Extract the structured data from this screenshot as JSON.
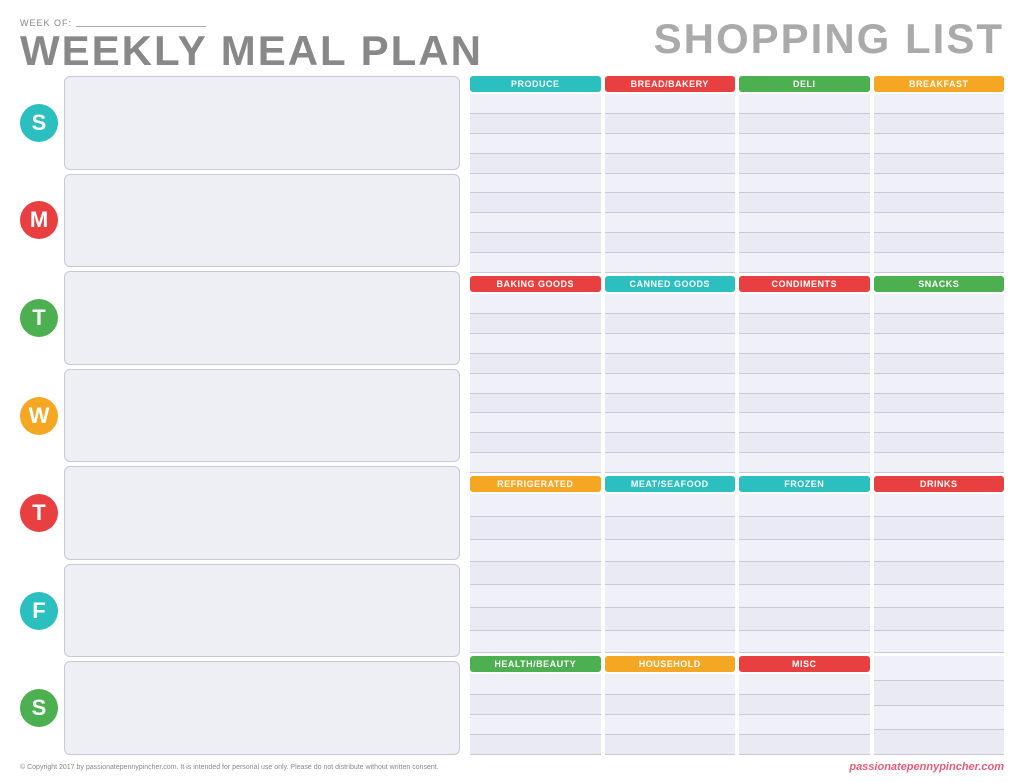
{
  "header": {
    "week_of_label": "WEEK OF:",
    "title": "WEEKLY MEAL PLAN",
    "shopping_title": "SHOPPING LIST"
  },
  "days": [
    {
      "letter": "S",
      "color_class": "day-sun"
    },
    {
      "letter": "M",
      "color_class": "day-mon"
    },
    {
      "letter": "T",
      "color_class": "day-tue"
    },
    {
      "letter": "W",
      "color_class": "day-wed"
    },
    {
      "letter": "T",
      "color_class": "day-thu"
    },
    {
      "letter": "F",
      "color_class": "day-fri"
    },
    {
      "letter": "S",
      "color_class": "day-sat"
    }
  ],
  "shopping": {
    "top": [
      {
        "label": "PRODUCE",
        "color": "#2bbfbf",
        "lines": 9
      },
      {
        "label": "BREAD/BAKERY",
        "color": "#e84040",
        "lines": 9
      },
      {
        "label": "DELI",
        "color": "#4caf50",
        "lines": 9
      },
      {
        "label": "BREAKFAST",
        "color": "#f5a623",
        "lines": 9
      }
    ],
    "mid": [
      {
        "label": "BAKING GOODS",
        "color": "#e84040",
        "lines": 9
      },
      {
        "label": "CANNED GOODS",
        "color": "#2bbfbf",
        "lines": 9
      },
      {
        "label": "CONDIMENTS",
        "color": "#e84040",
        "lines": 9
      },
      {
        "label": "SNACKS",
        "color": "#4caf50",
        "lines": 9
      }
    ],
    "bot3": [
      {
        "label": "REFRIGERATED",
        "color": "#f5a623",
        "lines": 7
      },
      {
        "label": "MEAT/SEAFOOD",
        "color": "#2bbfbf",
        "lines": 7
      },
      {
        "label": "FROZEN",
        "color": "#2bbfbf",
        "lines": 7
      },
      {
        "label": "DRINKS",
        "color": "#e84040",
        "lines": 7
      }
    ],
    "bot4": [
      {
        "label": "HEALTH/BEAUTY",
        "color": "#4caf50",
        "lines": 4
      },
      {
        "label": "HOUSEHOLD",
        "color": "#f5a623",
        "lines": 4
      },
      {
        "label": "MISC",
        "color": "#e84040",
        "lines": 4
      },
      {
        "label": "",
        "color": "transparent",
        "lines": 4
      }
    ]
  },
  "footer": {
    "copyright": "© Copyright 2017 by passionatepennypincher.com. It is intended for personal use only. Please do not distribute without written consent.",
    "brand": "passionatepennypincher.com"
  }
}
